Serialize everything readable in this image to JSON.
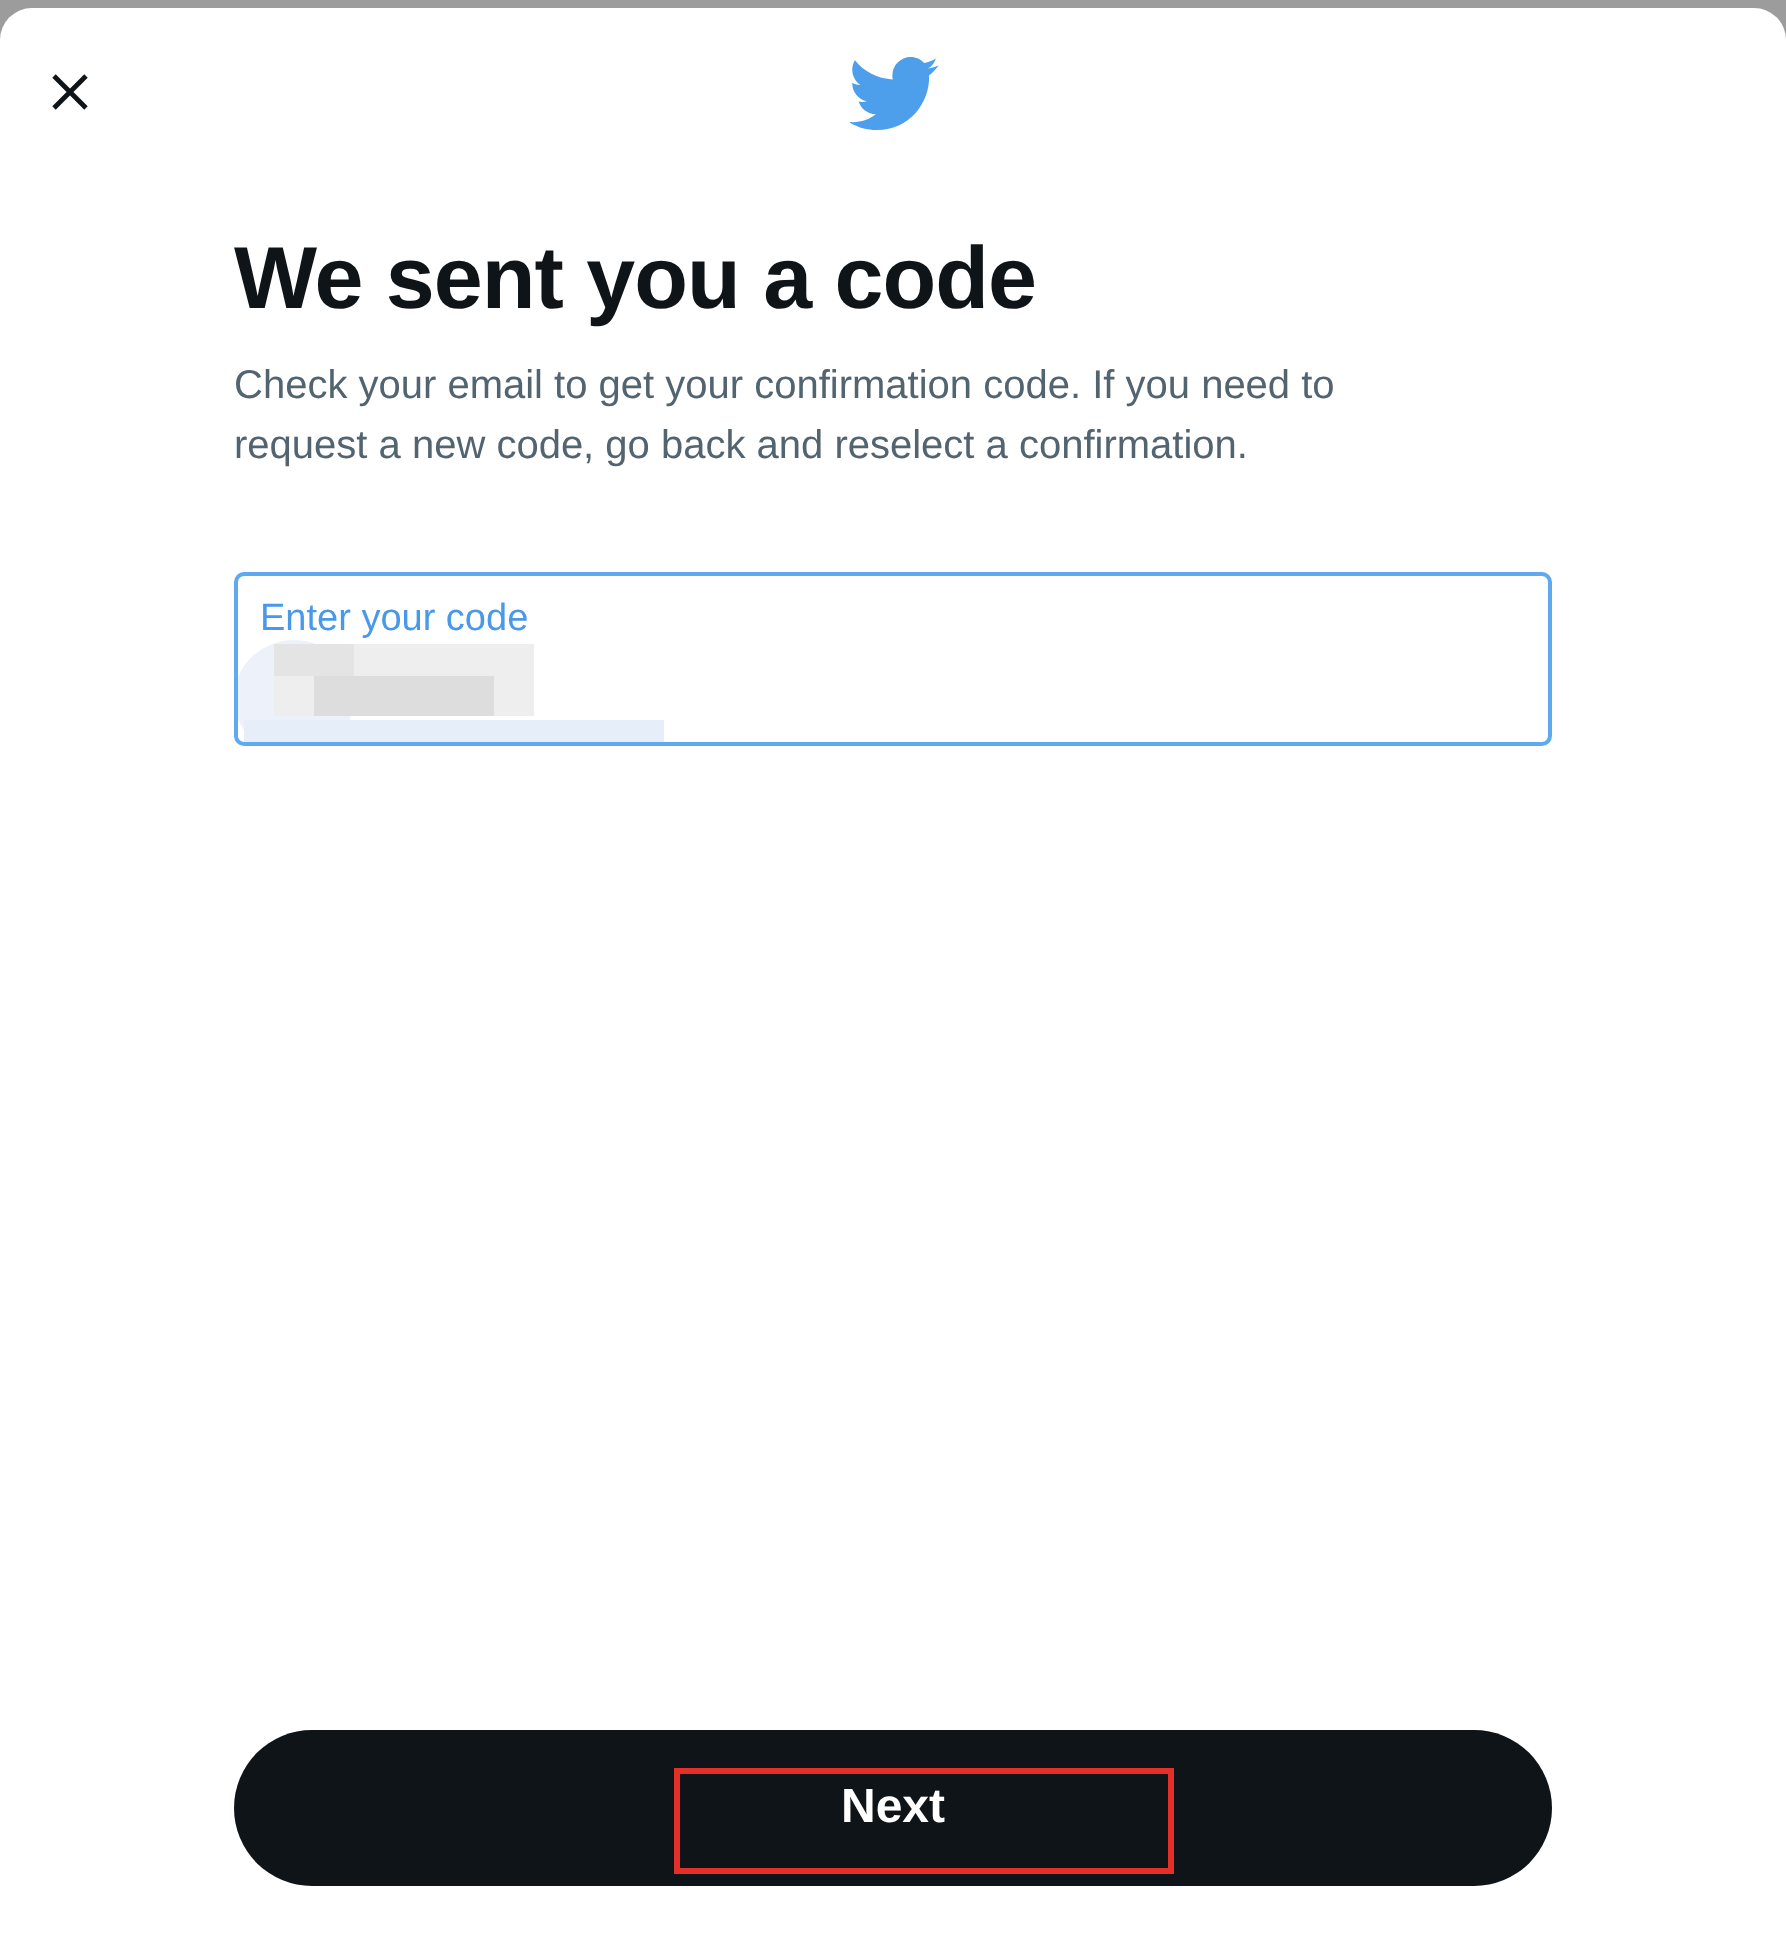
{
  "heading": "We sent you a code",
  "description": "Check your email to get your confirmation code. If you need to request a new code, go back and reselect a confirmation.",
  "code_field": {
    "label": "Enter your code",
    "focused": true,
    "redacted": true
  },
  "next_button": {
    "label": "Next",
    "highlighted": true
  }
}
